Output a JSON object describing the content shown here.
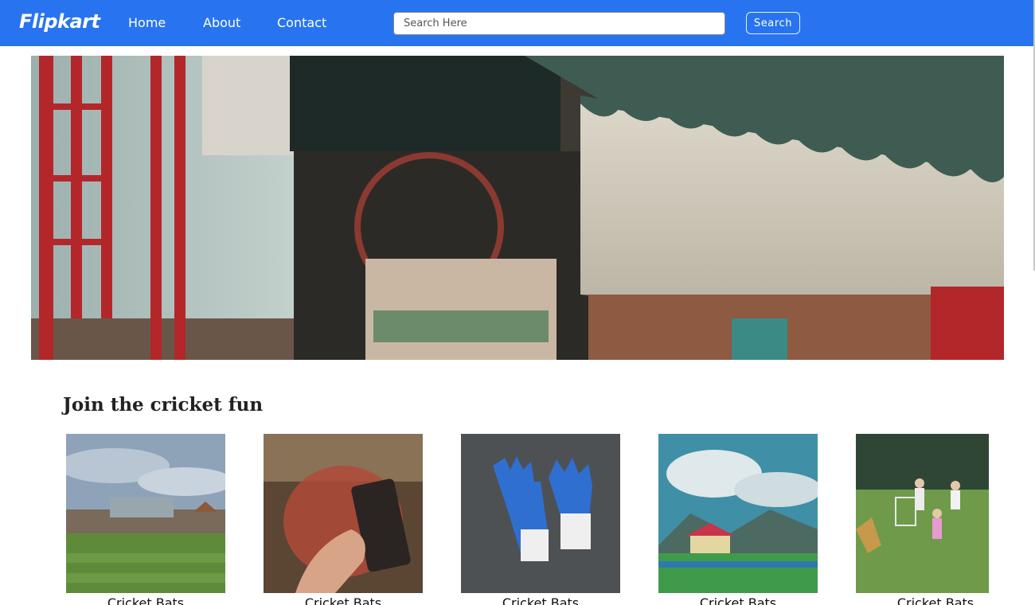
{
  "navbar": {
    "brand": "Flipkart",
    "links": [
      "Home",
      "About",
      "Contact"
    ],
    "search_placeholder": "Search Here",
    "search_button": "Search"
  },
  "colors": {
    "navbar_bg": "#2874f0",
    "nav_text": "#ffffff"
  },
  "hero": {
    "image_desc": "storefront-awning-photo"
  },
  "section": {
    "title": "Join the cricket fun"
  },
  "products": [
    {
      "label": "Cricket Bats",
      "image": "stadium-photo"
    },
    {
      "label": "Cricket Bats",
      "image": "phone-in-hand-photo"
    },
    {
      "label": "Cricket Bats",
      "image": "gloves-photo"
    },
    {
      "label": "Cricket Bats",
      "image": "mountain-stadium-photo"
    },
    {
      "label": "Cricket Bats",
      "image": "kids-playing-photo"
    }
  ]
}
